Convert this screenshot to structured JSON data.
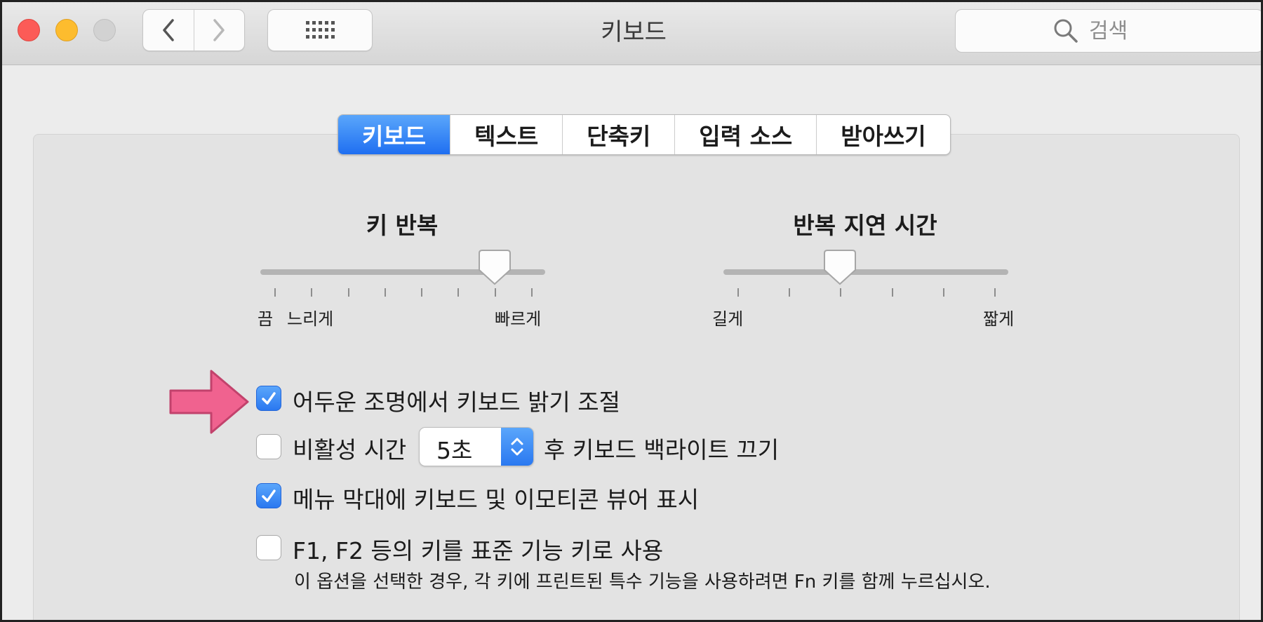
{
  "window": {
    "title": "키보드",
    "search_placeholder": "검색"
  },
  "tabs": [
    {
      "label": "키보드",
      "active": true
    },
    {
      "label": "텍스트",
      "active": false
    },
    {
      "label": "단축키",
      "active": false
    },
    {
      "label": "입력 소스",
      "active": false
    },
    {
      "label": "받아쓰기",
      "active": false
    }
  ],
  "sliders": {
    "key_repeat": {
      "title": "키 반복",
      "labels": {
        "off": "끔",
        "slow": "느리게",
        "fast": "빠르게"
      },
      "value_step": 6,
      "steps": 8
    },
    "repeat_delay": {
      "title": "반복 지연 시간",
      "labels": {
        "long": "길게",
        "short": "짧게"
      },
      "value_step": 2,
      "steps": 6
    }
  },
  "options": {
    "auto_brightness": {
      "label": "어두운 조명에서 키보드 밝기 조절",
      "checked": true
    },
    "backlight_off": {
      "label_before": "비활성 시간",
      "popup_value": "5초",
      "label_after": "후 키보드 백라이트 끄기",
      "checked": false
    },
    "menu_bar_viewer": {
      "label": "메뉴 막대에 키보드 및 이모티콘 뷰어 표시",
      "checked": true
    },
    "fn_keys": {
      "label": "F1, F2 등의 키를 표준 기능 키로 사용",
      "note": "이 옵션을 선택한 경우, 각 키에 프린트된 특수 기능을 사용하려면 Fn 키를 함께 누르십시오.",
      "checked": false
    }
  },
  "colors": {
    "accent": "#2a78f0",
    "annotation_arrow": "#f0628f"
  }
}
